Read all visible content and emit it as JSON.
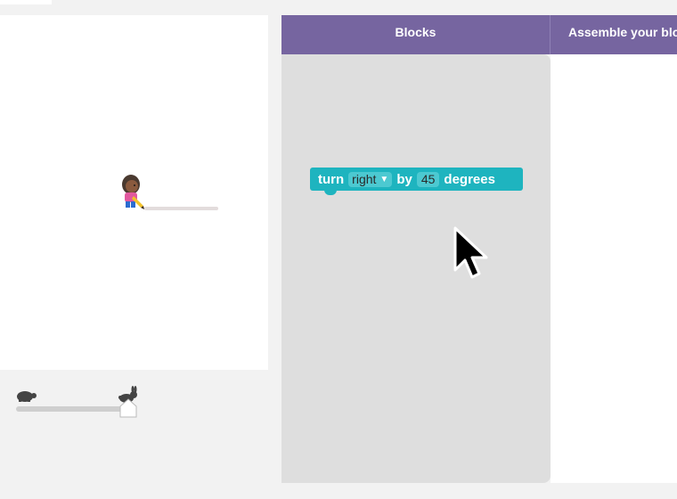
{
  "header": {
    "blocks_label": "Blocks",
    "workspace_label": "Assemble your bloc"
  },
  "toolbox": {
    "block": {
      "verb": "turn",
      "direction": "right",
      "by_label": "by",
      "value": "45",
      "unit": "degrees"
    }
  },
  "speed_slider": {
    "level": 1.0
  },
  "colors": {
    "header_bg": "#7665a0",
    "block_bg": "#1eb4bf",
    "toolbox_bg": "#dedede"
  },
  "icons": {
    "artist": "artist-character-icon",
    "slow": "turtle-icon",
    "fast": "rabbit-icon",
    "pointer": "mouse-cursor-icon"
  }
}
